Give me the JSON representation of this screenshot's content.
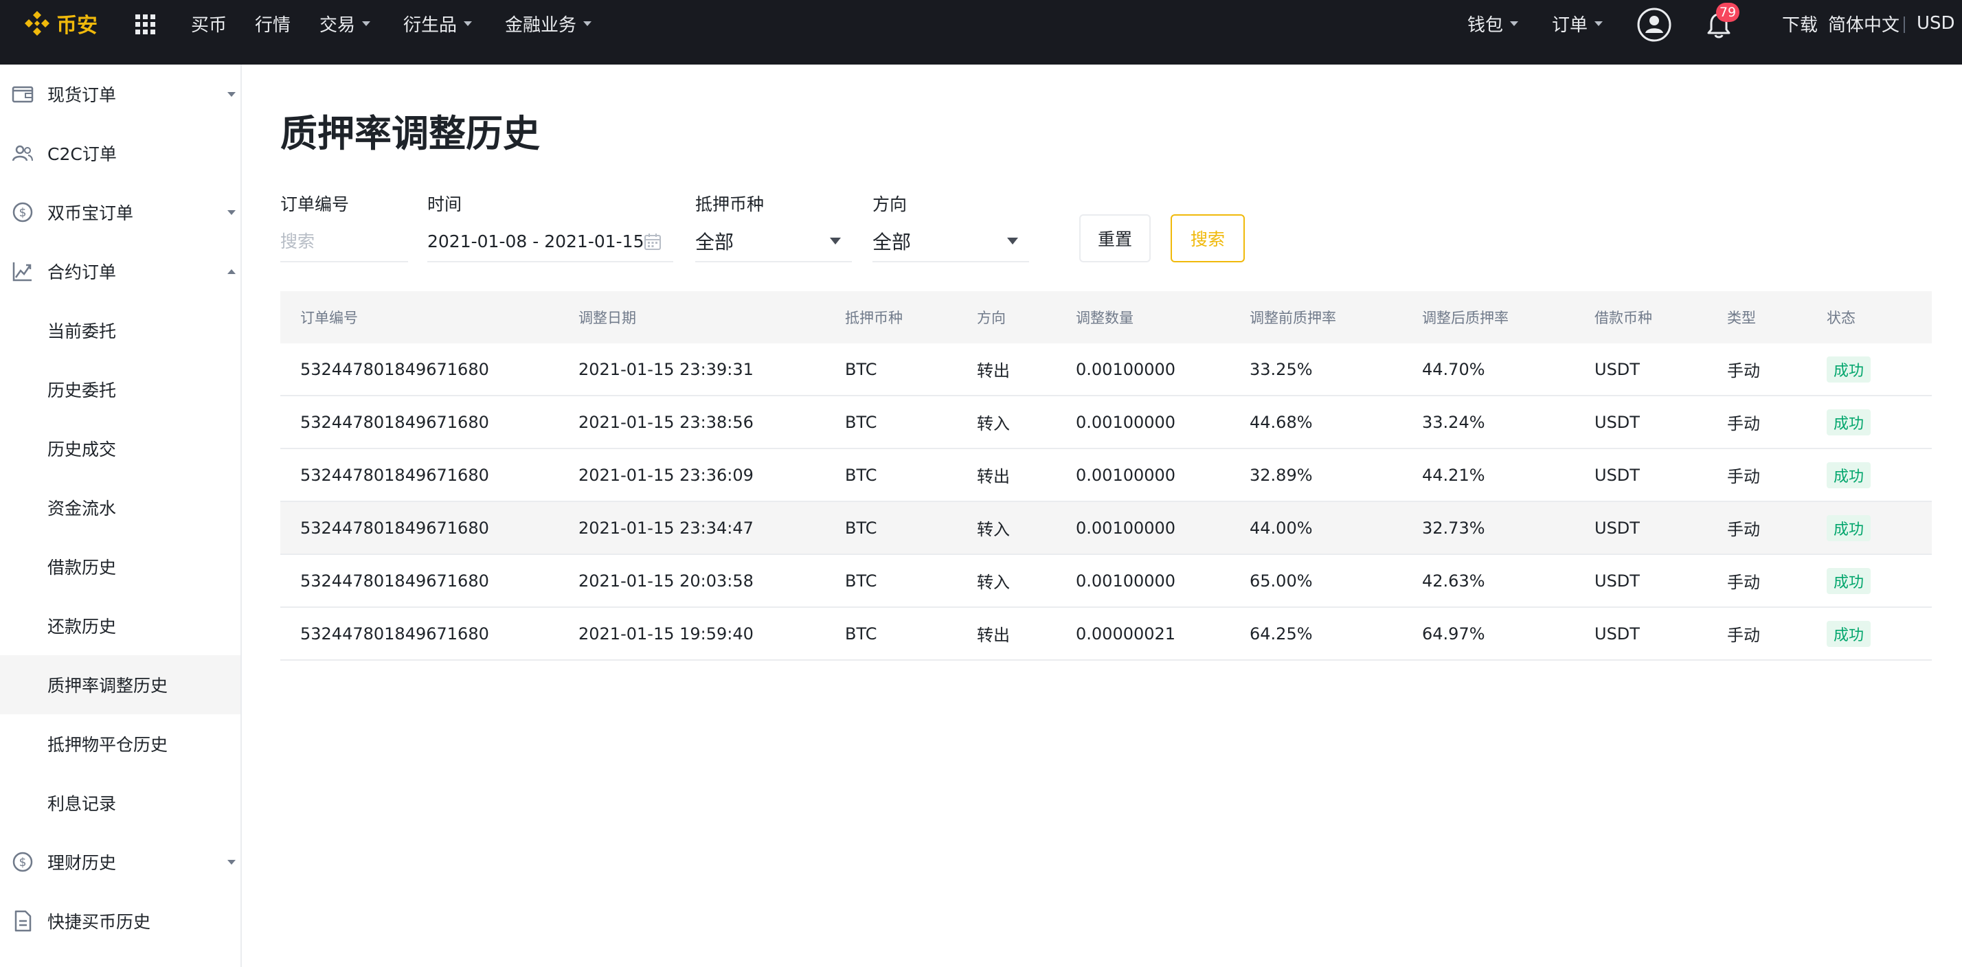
{
  "header": {
    "logo_text": "币安",
    "nav": [
      {
        "label": "买币",
        "dropdown": false
      },
      {
        "label": "行情",
        "dropdown": false
      },
      {
        "label": "交易",
        "dropdown": true
      },
      {
        "label": "衍生品",
        "dropdown": true
      },
      {
        "label": "金融业务",
        "dropdown": true
      }
    ],
    "right": {
      "wallet": "钱包",
      "orders": "订单",
      "notification_count": "79",
      "download": "下载",
      "language": "简体中文",
      "currency": "USD"
    },
    "accent_color": "#f0b90b",
    "bar_color": "#181a20"
  },
  "sidebar": {
    "items": [
      {
        "label": "现货订单",
        "icon": "wallet-icon",
        "caret": "down"
      },
      {
        "label": "C2C订单",
        "icon": "users-icon",
        "caret": ""
      },
      {
        "label": "双币宝订单",
        "icon": "dollar-circle-icon",
        "caret": "down"
      },
      {
        "label": "合约订单",
        "icon": "futures-chart-icon",
        "caret": "up"
      },
      {
        "label": "当前委托",
        "icon": "",
        "caret": ""
      },
      {
        "label": "历史委托",
        "icon": "",
        "caret": ""
      },
      {
        "label": "历史成交",
        "icon": "",
        "caret": ""
      },
      {
        "label": "资金流水",
        "icon": "",
        "caret": ""
      },
      {
        "label": "借款历史",
        "icon": "",
        "caret": ""
      },
      {
        "label": "还款历史",
        "icon": "",
        "caret": ""
      },
      {
        "label": "质押率调整历史",
        "icon": "",
        "caret": "",
        "active": true
      },
      {
        "label": "抵押物平仓历史",
        "icon": "",
        "caret": ""
      },
      {
        "label": "利息记录",
        "icon": "",
        "caret": ""
      },
      {
        "label": "理财历史",
        "icon": "dollar-circle-icon",
        "caret": "down"
      },
      {
        "label": "快捷买币历史",
        "icon": "document-icon",
        "caret": ""
      }
    ]
  },
  "page": {
    "title": "质押率调整历史"
  },
  "filters": {
    "order_no": {
      "label": "订单编号",
      "value": "",
      "placeholder": "搜索"
    },
    "time": {
      "label": "时间",
      "value": "2021-01-08 - 2021-01-15"
    },
    "collateral": {
      "label": "抵押币种",
      "value": "全部"
    },
    "direction": {
      "label": "方向",
      "value": "全部"
    },
    "reset_label": "重置",
    "search_label": "搜索"
  },
  "table": {
    "columns": [
      "订单编号",
      "调整日期",
      "抵押币种",
      "方向",
      "调整数量",
      "调整前质押率",
      "调整后质押率",
      "借款币种",
      "类型",
      "状态"
    ],
    "rows": [
      [
        "532447801849671680",
        "2021-01-15 23:39:31",
        "BTC",
        "转出",
        "0.00100000",
        "33.25%",
        "44.70%",
        "USDT",
        "手动",
        "成功"
      ],
      [
        "532447801849671680",
        "2021-01-15 23:38:56",
        "BTC",
        "转入",
        "0.00100000",
        "44.68%",
        "33.24%",
        "USDT",
        "手动",
        "成功"
      ],
      [
        "532447801849671680",
        "2021-01-15 23:36:09",
        "BTC",
        "转出",
        "0.00100000",
        "32.89%",
        "44.21%",
        "USDT",
        "手动",
        "成功"
      ],
      [
        "532447801849671680",
        "2021-01-15 23:34:47",
        "BTC",
        "转入",
        "0.00100000",
        "44.00%",
        "32.73%",
        "USDT",
        "手动",
        "成功"
      ],
      [
        "532447801849671680",
        "2021-01-15 20:03:58",
        "BTC",
        "转入",
        "0.00100000",
        "65.00%",
        "42.63%",
        "USDT",
        "手动",
        "成功"
      ],
      [
        "532447801849671680",
        "2021-01-15 19:59:40",
        "BTC",
        "转出",
        "0.00000021",
        "64.25%",
        "64.97%",
        "USDT",
        "手动",
        "成功"
      ]
    ],
    "status_color": "#03a66d"
  }
}
